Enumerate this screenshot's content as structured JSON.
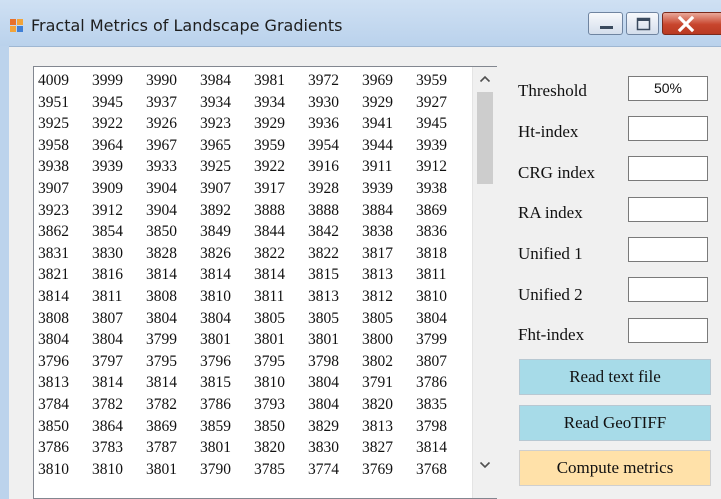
{
  "window": {
    "title": "Fractal Metrics of Landscape Gradients",
    "icons": [
      "app-icon",
      "minimize-icon",
      "maximize-icon",
      "close-icon"
    ]
  },
  "data_rows": [
    [
      "4009",
      "3999",
      "3990",
      "3984",
      "3981",
      "3972",
      "3969",
      "3959"
    ],
    [
      "3951",
      "3945",
      "3937",
      "3934",
      "3934",
      "3930",
      "3929",
      "3927"
    ],
    [
      "3925",
      "3922",
      "3926",
      "3923",
      "3929",
      "3936",
      "3941",
      "3945"
    ],
    [
      "3958",
      "3964",
      "3967",
      "3965",
      "3959",
      "3954",
      "3944",
      "3939"
    ],
    [
      "3938",
      "3939",
      "3933",
      "3925",
      "3922",
      "3916",
      "3911",
      "3912"
    ],
    [
      "3907",
      "3909",
      "3904",
      "3907",
      "3917",
      "3928",
      "3939",
      "3938"
    ],
    [
      "3923",
      "3912",
      "3904",
      "3892",
      "3888",
      "3888",
      "3884",
      "3869"
    ],
    [
      "3862",
      "3854",
      "3850",
      "3849",
      "3844",
      "3842",
      "3838",
      "3836"
    ],
    [
      "3831",
      "3830",
      "3828",
      "3826",
      "3822",
      "3822",
      "3817",
      "3818"
    ],
    [
      "3821",
      "3816",
      "3814",
      "3814",
      "3814",
      "3815",
      "3813",
      "3811"
    ],
    [
      "3814",
      "3811",
      "3808",
      "3810",
      "3811",
      "3813",
      "3812",
      "3810"
    ],
    [
      "3808",
      "3807",
      "3804",
      "3804",
      "3805",
      "3805",
      "3805",
      "3804"
    ],
    [
      "3804",
      "3804",
      "3799",
      "3801",
      "3801",
      "3801",
      "3800",
      "3799"
    ],
    [
      "3796",
      "3797",
      "3795",
      "3796",
      "3795",
      "3798",
      "3802",
      "3807"
    ],
    [
      "3813",
      "3814",
      "3814",
      "3815",
      "3810",
      "3804",
      "3791",
      "3786"
    ],
    [
      "3784",
      "3782",
      "3782",
      "3786",
      "3793",
      "3804",
      "3820",
      "3835"
    ],
    [
      "3850",
      "3864",
      "3869",
      "3859",
      "3850",
      "3829",
      "3813",
      "3798"
    ],
    [
      "3786",
      "3783",
      "3787",
      "3801",
      "3820",
      "3830",
      "3827",
      "3814"
    ],
    [
      "3810",
      "3810",
      "3801",
      "3790",
      "3785",
      "3774",
      "3769",
      "3768"
    ]
  ],
  "metrics": {
    "threshold_label": "Threshold",
    "threshold_value": "50%",
    "ht_label": "Ht-index",
    "ht_value": "",
    "crg_label": "CRG index",
    "crg_value": "",
    "ra_label": "RA index",
    "ra_value": "",
    "unified1_label": "Unified 1",
    "unified1_value": "",
    "unified2_label": "Unified 2",
    "unified2_value": "",
    "fht_label": "Fht-index",
    "fht_value": ""
  },
  "buttons": {
    "read_text": "Read text file",
    "read_geotiff": "Read GeoTIFF",
    "compute": "Compute metrics"
  },
  "colors": {
    "button_blue": "#a7dbe8",
    "button_orange": "#ffe1a9"
  }
}
